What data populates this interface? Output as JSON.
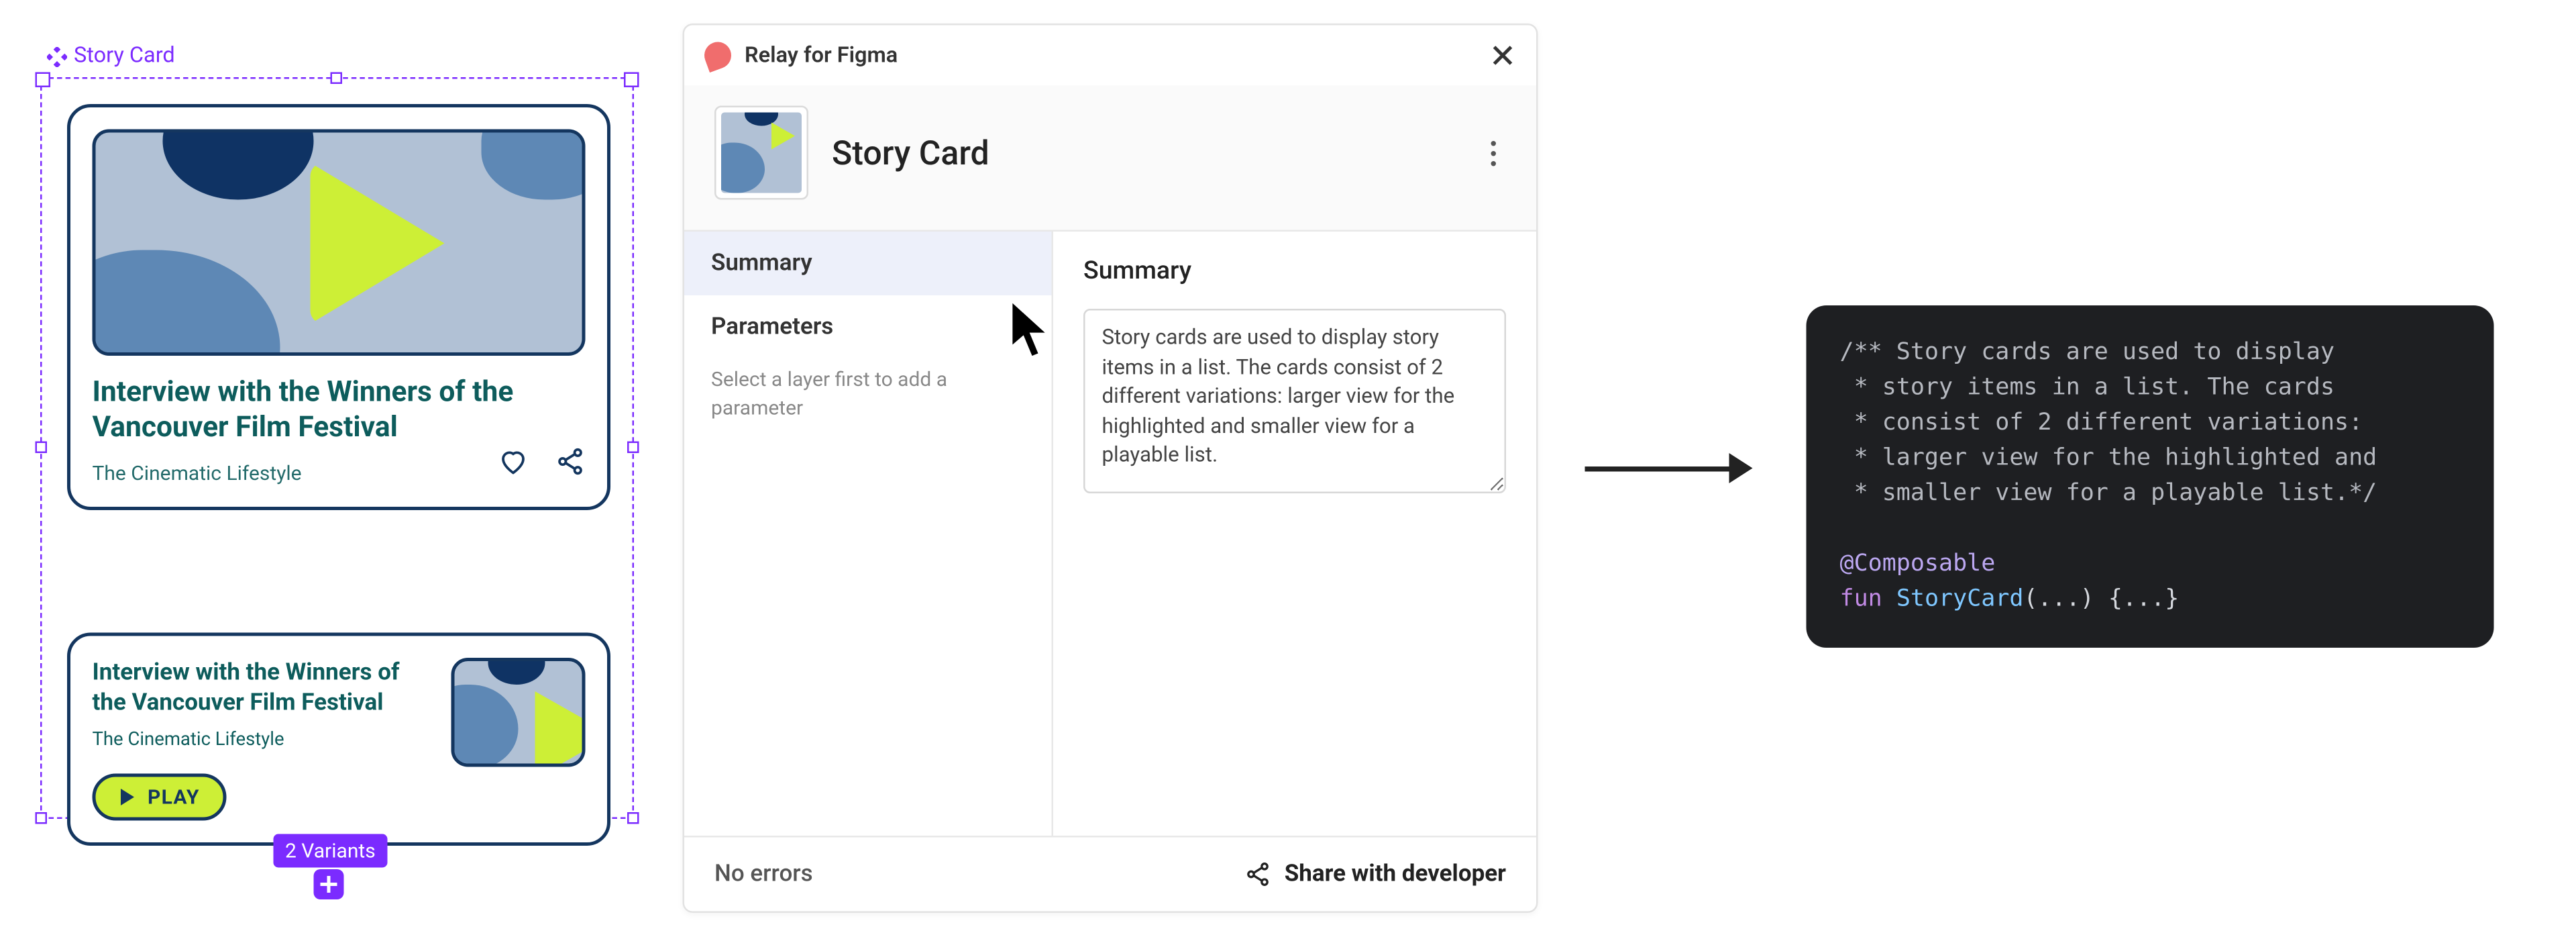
{
  "figma": {
    "component_label": "Story Card",
    "variant_badge": "2 Variants"
  },
  "story_card_large": {
    "title": "Interview with the Winners of the Vancouver Film Festival",
    "subtitle": "The Cinematic Lifestyle"
  },
  "story_card_small": {
    "title": "Interview with the Winners of the Vancouver Film Festival",
    "subtitle": "The Cinematic Lifestyle",
    "play_label": "PLAY"
  },
  "relay": {
    "app_title": "Relay for Figma",
    "component_name": "Story Card",
    "tabs": {
      "summary": "Summary",
      "parameters": "Parameters"
    },
    "sidebar_hint": "Select a layer first to add a parameter",
    "main_heading": "Summary",
    "summary_text": "Story cards are used to display story items in a list. The cards consist of 2 different variations: larger view for the highlighted and smaller view for a playable list.",
    "footer_status": "No errors",
    "share_label": "Share with developer"
  },
  "code": {
    "l1": "/** Story cards are used to display",
    "l2": " * story items in a list. The cards",
    "l3": " * consist of 2 different variations:",
    "l4": " * larger view for the highlighted and",
    "l5": " * smaller view for a playable list.*/",
    "annotation": "@Composable",
    "kw_fun": "fun",
    "fn_name": "StoryCard",
    "signature_tail": "(...) {...}"
  }
}
